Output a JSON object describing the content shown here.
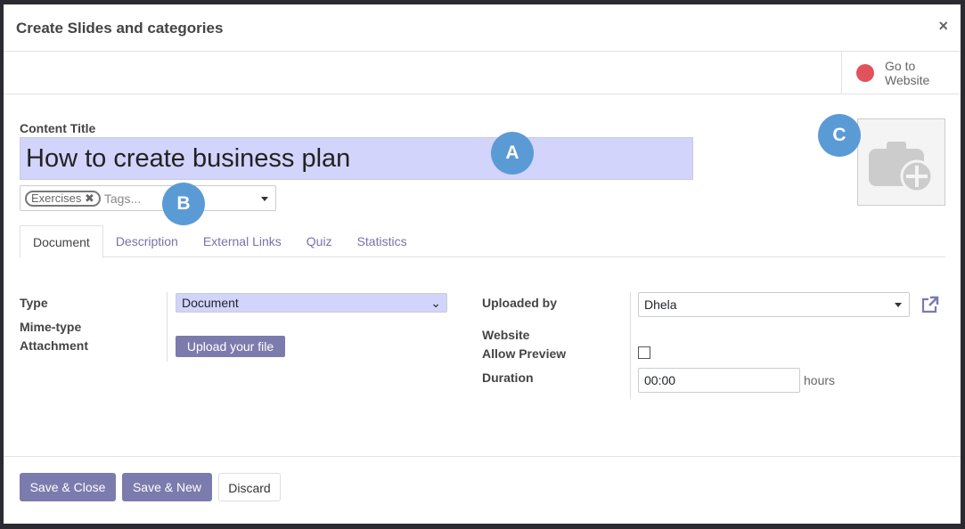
{
  "dialog": {
    "title": "Create Slides and categories",
    "close": "×"
  },
  "smart_button": {
    "label_line1": "Go to",
    "label_line2": "Website",
    "icon": "globe-icon"
  },
  "form": {
    "content_title_label": "Content Title",
    "content_title_value": "How to create business plan",
    "tags": [
      "Exercises"
    ],
    "tags_placeholder": "Tags...",
    "annotations": [
      "A",
      "B",
      "C"
    ],
    "tabs": [
      "Document",
      "Description",
      "External Links",
      "Quiz",
      "Statistics"
    ],
    "active_tab": "Document",
    "type_label": "Type",
    "type_value": "Document",
    "mime_label": "Mime-type",
    "attachment_label": "Attachment",
    "upload_button": "Upload your file",
    "uploaded_by_label": "Uploaded by",
    "uploaded_by_value": "Dhela",
    "website_label": "Website",
    "allow_preview_label": "Allow Preview",
    "allow_preview": false,
    "duration_label": "Duration",
    "duration_value": "00:00",
    "duration_unit": "hours"
  },
  "footer": {
    "save_close": "Save & Close",
    "save_new": "Save & New",
    "discard": "Discard"
  },
  "colors": {
    "primary": "#7c7bad",
    "title_bg": "#d2d4fc",
    "badge": "#5b9bd5"
  }
}
